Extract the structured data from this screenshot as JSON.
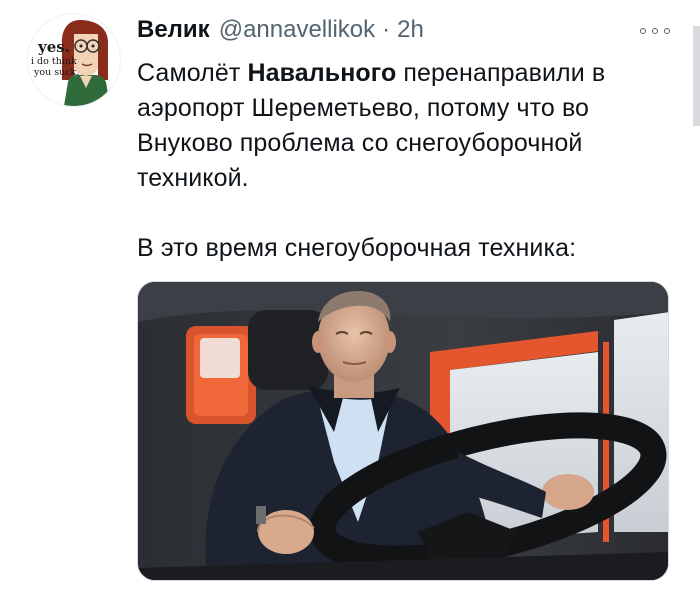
{
  "tweet": {
    "author_name": "Велик",
    "author_handle": "@annavellikok",
    "separator": "·",
    "time": "2h",
    "text_lines": [
      {
        "before": "Самолёт ",
        "bold": "Навального",
        "after": " перенаправили в"
      },
      {
        "before": "аэропорт Шереметьево, потому что во"
      },
      {
        "before": "Внуково проблема со снегоуборочной"
      },
      {
        "before": "техникой."
      },
      {
        "before": "В это время снегоуборочная техника:"
      }
    ]
  },
  "avatar": {
    "line1": "yes.",
    "line2": "i do think",
    "line3": "you suck."
  },
  "icons": {
    "more": "more-options-icon"
  },
  "colors": {
    "text": "#0f1419",
    "muted": "#536471",
    "border": "#cfd9de",
    "truck_orange": "#e4572e"
  }
}
